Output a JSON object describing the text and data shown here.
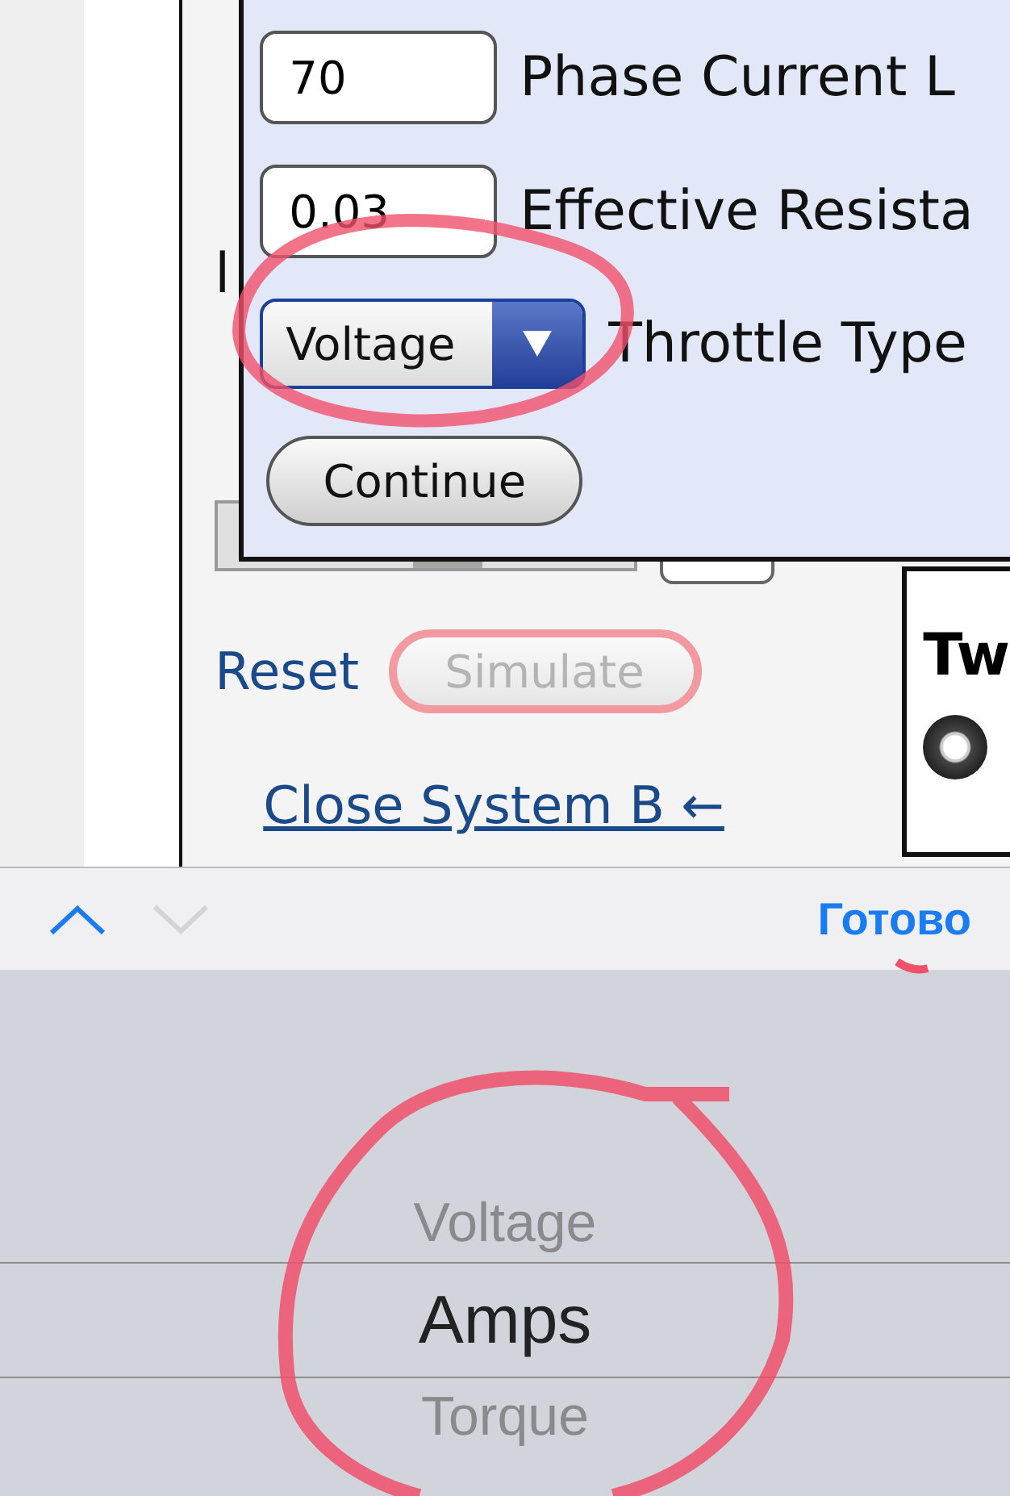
{
  "page": {
    "behind_texts": [
      "l"
    ],
    "slider": {
      "level": 0.55
    },
    "reset_link": "Reset",
    "simulate_button": {
      "label": "Simulate",
      "disabled": true
    },
    "close_link": "Close System B ←",
    "side_panel": {
      "heading": "Tw",
      "radio": {
        "selected": true
      }
    }
  },
  "modal": {
    "fields": [
      {
        "kind": "input",
        "value": "70",
        "label": "Phase Current L"
      },
      {
        "kind": "input",
        "value": "0.03",
        "label": "Effective Resista"
      },
      {
        "kind": "select",
        "value": "Voltage",
        "label": "Throttle Type"
      }
    ],
    "button": "Continue"
  },
  "keyboard_toolbar": {
    "previous": {
      "disabled": false
    },
    "next": {
      "disabled": true
    },
    "done": "Готово"
  },
  "picker": {
    "options": [
      {
        "label": "Voltage",
        "selected": false
      },
      {
        "label": "Amps",
        "selected": true
      },
      {
        "label": "Torque",
        "selected": false
      }
    ]
  }
}
